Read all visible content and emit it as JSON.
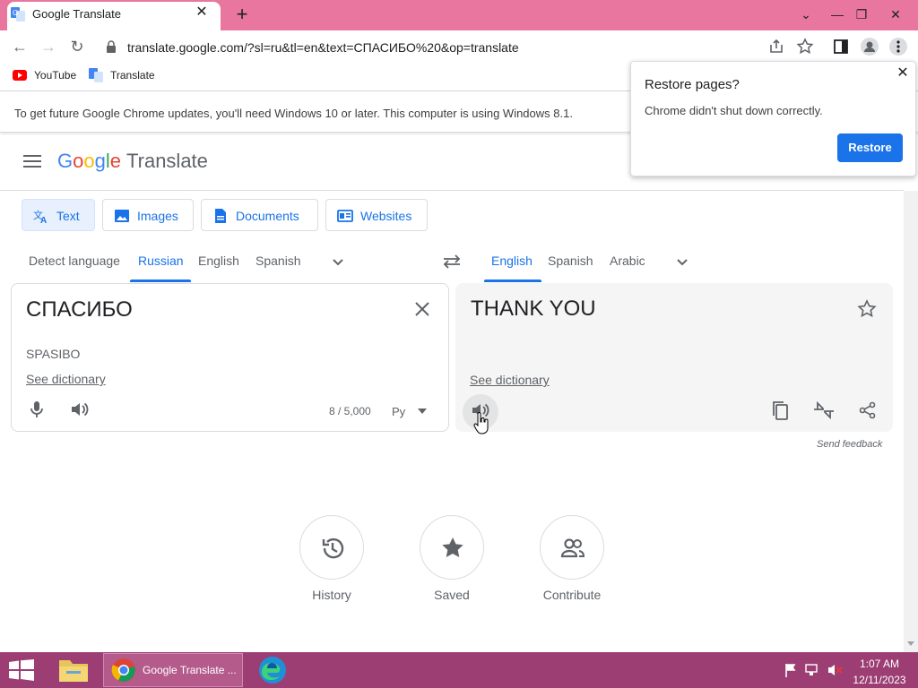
{
  "browser": {
    "tab_title": "Google Translate",
    "url": "translate.google.com/?sl=ru&tl=en&text=СПАСИБО%20&op=translate",
    "bookmarks": [
      "YouTube",
      "Translate"
    ],
    "infobar": "To get future Google Chrome updates, you'll need Windows 10 or later. This computer is using Windows 8.1."
  },
  "restore_popup": {
    "title": "Restore pages?",
    "message": "Chrome didn't shut down correctly.",
    "button": "Restore"
  },
  "header": {
    "logo": {
      "g1": "G",
      "o1": "o",
      "o2": "o",
      "g2": "g",
      "l": "l",
      "e": "e",
      "product": "Translate"
    }
  },
  "modes": [
    "Text",
    "Images",
    "Documents",
    "Websites"
  ],
  "source_langs": {
    "detect": "Detect language",
    "items": [
      "Russian",
      "English",
      "Spanish"
    ],
    "active": "Russian"
  },
  "target_langs": {
    "items": [
      "English",
      "Spanish",
      "Arabic"
    ],
    "active": "English"
  },
  "source": {
    "text": "СПАСИБО",
    "transliteration": "SPASIBO",
    "dictionary": "See dictionary",
    "char_count": "8 / 5,000",
    "keyboard": "Ру"
  },
  "target": {
    "text": "THANK YOU",
    "dictionary": "See dictionary",
    "feedback": "Send feedback"
  },
  "actions": [
    "History",
    "Saved",
    "Contribute"
  ],
  "taskbar": {
    "chrome_label": "Google Translate ...",
    "time": "1:07 AM",
    "date": "12/11/2023"
  },
  "colors": {
    "accent": "#1a73e8",
    "tabstrip": "#e8769e",
    "taskbar": "#9c3e74"
  }
}
